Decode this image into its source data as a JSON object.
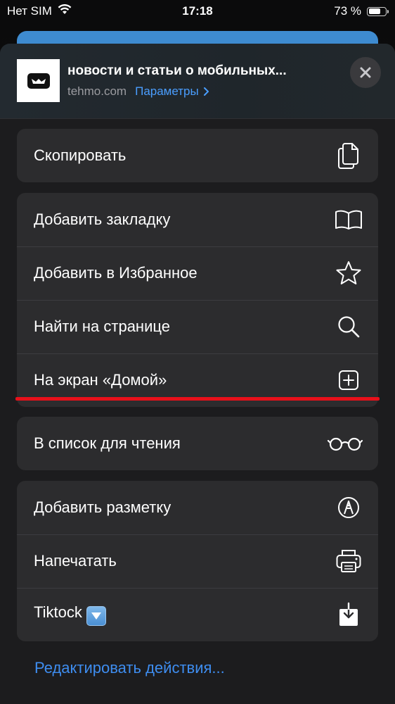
{
  "status_bar": {
    "carrier": "Нет SIM",
    "time": "17:18",
    "battery_text": "73 %",
    "battery_level": 0.73
  },
  "header": {
    "title": "новости и статьи о мобильных...",
    "domain": "tehmo.com",
    "params_label": "Параметры"
  },
  "groups": [
    {
      "items": [
        {
          "label": "Скопировать",
          "icon": "copy-icon"
        }
      ]
    },
    {
      "items": [
        {
          "label": "Добавить закладку",
          "icon": "book-icon"
        },
        {
          "label": "Добавить в Избранное",
          "icon": "star-icon"
        },
        {
          "label": "Найти на странице",
          "icon": "search-icon"
        },
        {
          "label": "На экран «Домой»",
          "icon": "plus-square-icon"
        }
      ]
    },
    {
      "items": [
        {
          "label": "В список для чтения",
          "icon": "glasses-icon"
        }
      ]
    },
    {
      "items": [
        {
          "label": "Добавить разметку",
          "icon": "markup-pen-icon"
        },
        {
          "label": "Напечатать",
          "icon": "printer-icon"
        },
        {
          "label": "Tiktock",
          "icon": "download-tray-icon"
        }
      ]
    }
  ],
  "footer": {
    "edit_actions": "Редактировать действия..."
  },
  "colors": {
    "accent": "#4a9eff",
    "highlight_underline": "#e8101a",
    "sheet": "#1c1c1e",
    "group": "#2c2c2e"
  }
}
